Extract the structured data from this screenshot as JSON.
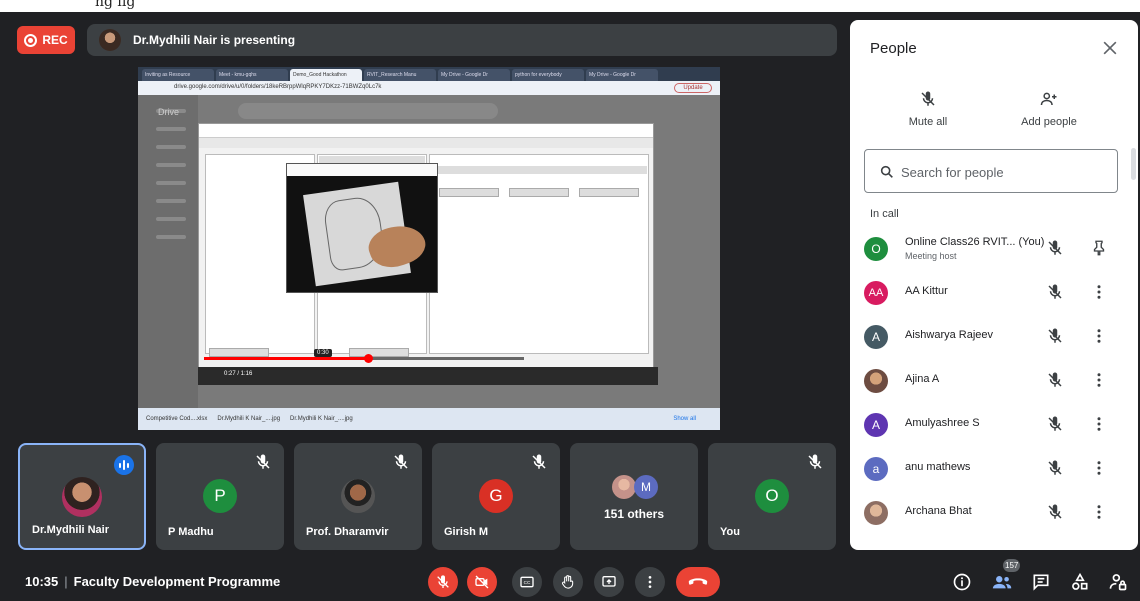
{
  "top_strip_text": "ng lig",
  "header": {
    "rec_label": "REC",
    "presenting_text": "Dr.Mydhili Nair is presenting"
  },
  "shared_screen": {
    "tabs": [
      "Inviting as Resource",
      "Meet - kmu-gqhs",
      "Demo_Good Hackathon",
      "RVIT_Research Manu",
      "My Drive - Google Dr",
      "python for everybody",
      "My Drive - Google Dr"
    ],
    "url": "drive.google.com/drive/u/0/folders/18keRBrppWlqRPKY7DKzz-71BWZq0Lc7k",
    "update_label": "Update",
    "drive_title": "Drive",
    "video_time_tooltip": "0:30",
    "video_time": "0:27 / 1:16",
    "downloads": [
      "Competitive Cod....xlsx",
      "Dr.Mydhili K Nair_....jpg",
      "Dr.Mydhili K Nair_....jpg"
    ],
    "show_all": "Show all"
  },
  "tiles": [
    {
      "name": "Dr.Mydhili Nair",
      "avatar": "photo",
      "speaking": true
    },
    {
      "name": "P Madhu",
      "initial": "P",
      "color": "#1e8e3e"
    },
    {
      "name": "Prof. Dharamvir",
      "avatar": "photo"
    },
    {
      "name": "Girish M",
      "initial": "G",
      "color": "#d93025"
    },
    {
      "name": "151 others",
      "initial": "M",
      "color": "#5c6bc0"
    },
    {
      "name": "You",
      "initial": "O",
      "color": "#1e8e3e"
    }
  ],
  "bottom": {
    "time": "10:35",
    "meeting_name": "Faculty Development Programme",
    "people_count": "157"
  },
  "panel": {
    "title": "People",
    "mute_all": "Mute all",
    "add_people": "Add people",
    "search_placeholder": "Search for people",
    "in_call": "In call",
    "people": [
      {
        "name": "Online Class26 RVIT... (You)",
        "sub": "Meeting host",
        "initial": "O",
        "color": "#1e8e3e",
        "pin": true
      },
      {
        "name": "AA Kittur",
        "initial": "AA",
        "color": "#d81b60"
      },
      {
        "name": "Aishwarya Rajeev",
        "initial": "A",
        "color": "#455a64"
      },
      {
        "name": "Ajina A",
        "initial": "",
        "color": "#8d6e63"
      },
      {
        "name": "Amulyashree S",
        "initial": "A",
        "color": "#5e35b1"
      },
      {
        "name": "anu mathews",
        "initial": "a",
        "color": "#5c6bc0"
      },
      {
        "name": "Archana Bhat",
        "initial": "",
        "color": "#a1887f"
      }
    ]
  },
  "colors": {
    "background": "#202124",
    "tile": "#3c4043",
    "red": "#ea4335",
    "accent": "#1a73e8"
  }
}
